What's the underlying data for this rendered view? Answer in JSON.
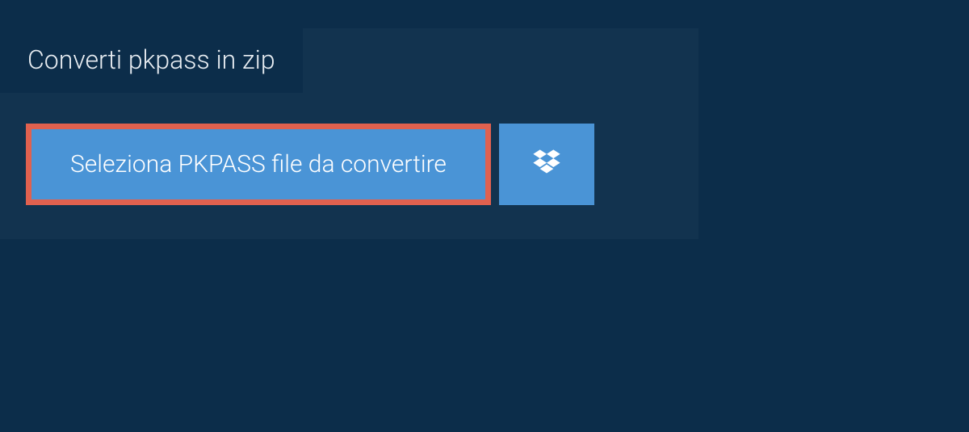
{
  "tab": {
    "label": "Converti pkpass in zip"
  },
  "buttons": {
    "select_file_label": "Seleziona PKPASS file da convertire"
  },
  "colors": {
    "page_bg": "#0c2d4a",
    "panel_bg": "#12334f",
    "button_bg": "#4a94d6",
    "highlight_border": "#e0614f"
  }
}
